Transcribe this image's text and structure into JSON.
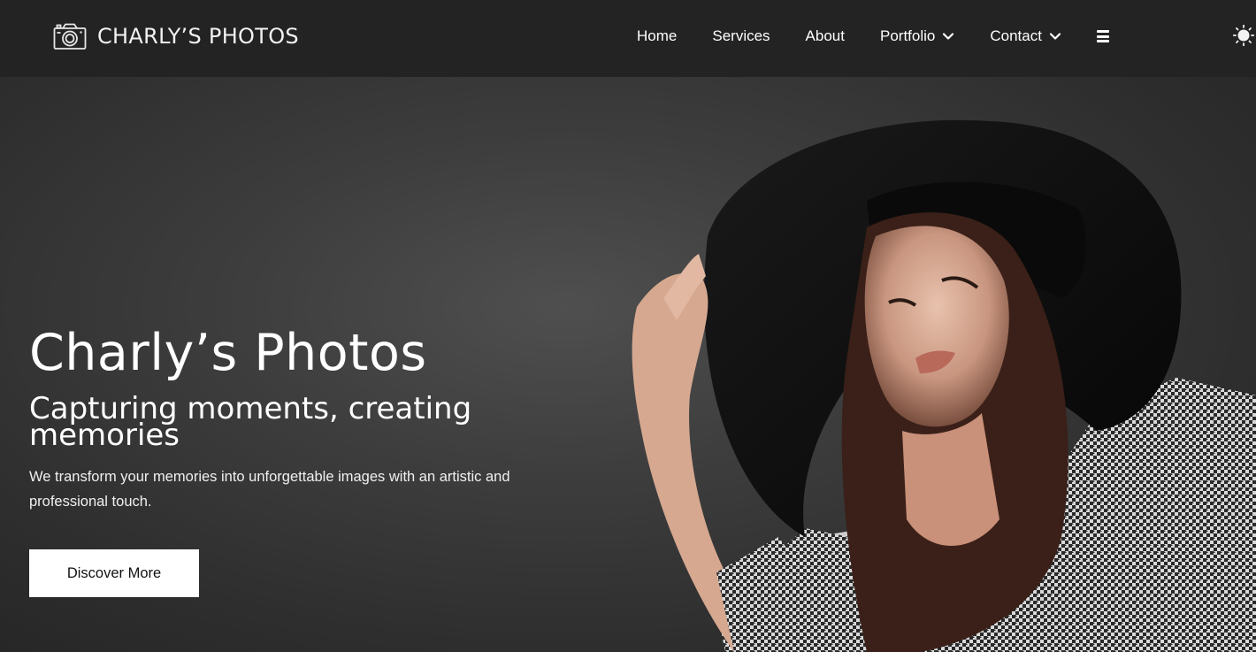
{
  "brand": {
    "name": "CHARLY’S PHOTOS",
    "logo_icon": "camera-icon"
  },
  "nav": {
    "items": [
      {
        "label": "Home"
      },
      {
        "label": "Services"
      },
      {
        "label": "About"
      },
      {
        "label": "Portfolio",
        "has_dropdown": true
      },
      {
        "label": "Contact",
        "has_dropdown": true
      }
    ],
    "menu_icon": "hamburger-icon",
    "theme_icon": "sun-icon"
  },
  "hero": {
    "title": "Charly’s Photos",
    "subtitle": "Capturing moments, creating memories",
    "text": "We transform your memories into unforgettable images with an artistic and professional touch.",
    "cta_label": "Discover More",
    "image": "woman-wide-brim-hat-photo"
  },
  "colors": {
    "navbar_bg": "#232323",
    "hero_bg": "#3d3d3d",
    "cta_bg": "#ffffff",
    "text": "#ffffff"
  }
}
